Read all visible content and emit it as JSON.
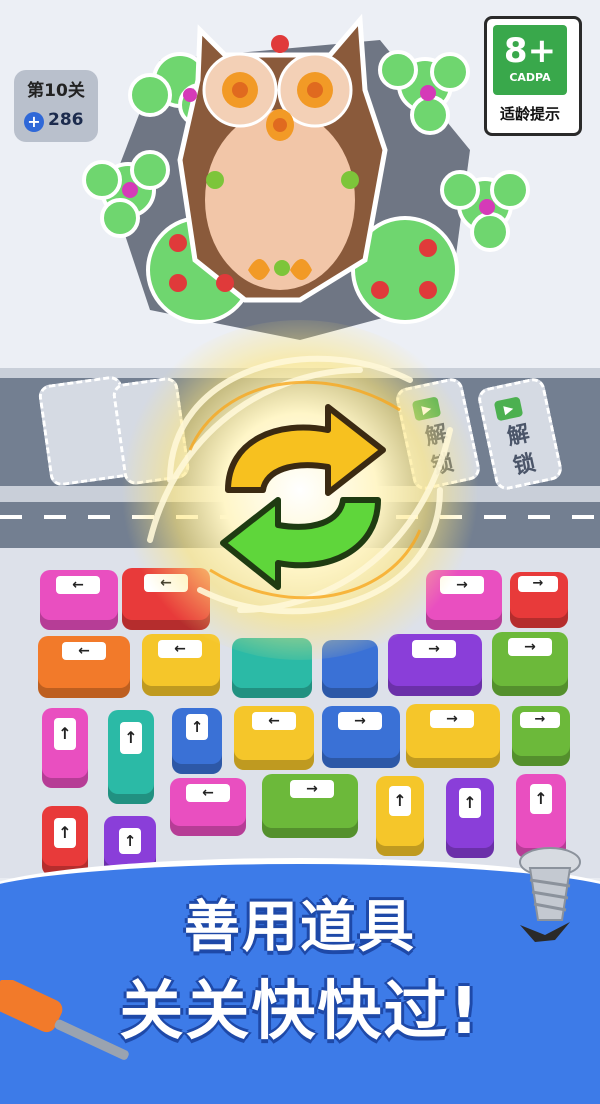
{
  "level": {
    "label": "第10关",
    "coins": "286",
    "coin_icon": "plus-coin-icon"
  },
  "age_rating": {
    "number": "8+",
    "org": "CADPA",
    "tip": "适龄提示"
  },
  "slots": {
    "unlock_label_1": "解锁",
    "unlock_label_2": "解锁",
    "unlock_partial": "锁"
  },
  "banner": {
    "line1": "善用道具",
    "line2": "关关快快过!"
  },
  "colors": {
    "accent_blue": "#3d7be8",
    "road": "#737f91",
    "green_arrow": "#5fd63b",
    "yellow_arrow": "#f7c11f"
  }
}
